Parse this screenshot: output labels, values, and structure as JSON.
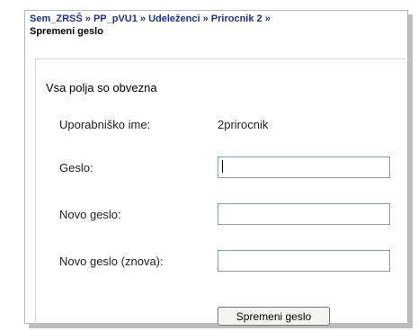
{
  "breadcrumb": {
    "items": [
      "Sem_ZRSŠ",
      "PP_pVU1",
      "Udeleženci",
      "Prirocnik 2"
    ],
    "separator": " » ",
    "current": "Spremeni geslo"
  },
  "form": {
    "required_note": "Vsa polja so obvezna",
    "username_label": "Uporabniško ime:",
    "username_value": "2prirocnik",
    "password_label": "Geslo:",
    "password_value": "",
    "new_password_label": "Novo geslo:",
    "new_password_value": "",
    "new_password_again_label": "Novo geslo (znova):",
    "new_password_again_value": "",
    "submit_label": "Spremeni geslo"
  },
  "colors": {
    "link": "#1a2fae",
    "field_border": "#7f9db9"
  }
}
